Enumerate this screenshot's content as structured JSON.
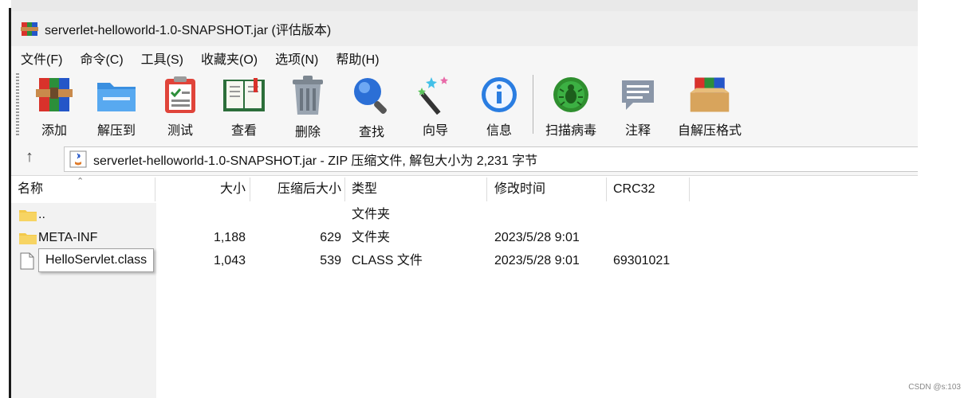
{
  "window": {
    "title": "serverlet-helloworld-1.0-SNAPSHOT.jar (评估版本)"
  },
  "menu": [
    "文件(F)",
    "命令(C)",
    "工具(S)",
    "收藏夹(O)",
    "选项(N)",
    "帮助(H)"
  ],
  "toolbar": {
    "add": "添加",
    "extract_to": "解压到",
    "test": "测试",
    "view": "查看",
    "delete": "删除",
    "find": "查找",
    "wizard": "向导",
    "info": "信息",
    "virus_scan": "扫描病毒",
    "comment": "注释",
    "sfx": "自解压格式"
  },
  "address": {
    "text": "serverlet-helloworld-1.0-SNAPSHOT.jar - ZIP 压缩文件, 解包大小为 2,231 字节"
  },
  "columns": {
    "name": "名称",
    "size": "大小",
    "packed": "压缩后大小",
    "type": "类型",
    "modified": "修改时间",
    "crc": "CRC32"
  },
  "rows": [
    {
      "name": "..",
      "size": "",
      "packed": "",
      "type": "文件夹",
      "modified": "",
      "crc": ""
    },
    {
      "name": "META-INF",
      "size": "1,188",
      "packed": "629",
      "type": "文件夹",
      "modified": "2023/5/28 9:01",
      "crc": ""
    },
    {
      "name": "HelloServlet.class",
      "size": "1,043",
      "packed": "539",
      "type": "CLASS 文件",
      "modified": "2023/5/28 9:01",
      "crc": "69301021"
    }
  ],
  "tooltip": "HelloServlet.class",
  "watermark": "CSDN @s:103",
  "colors": {
    "folder": "#f3c94b",
    "info_blue": "#2a7de1",
    "virus_green": "#3cb043",
    "find_blue": "#2b6fd6"
  }
}
